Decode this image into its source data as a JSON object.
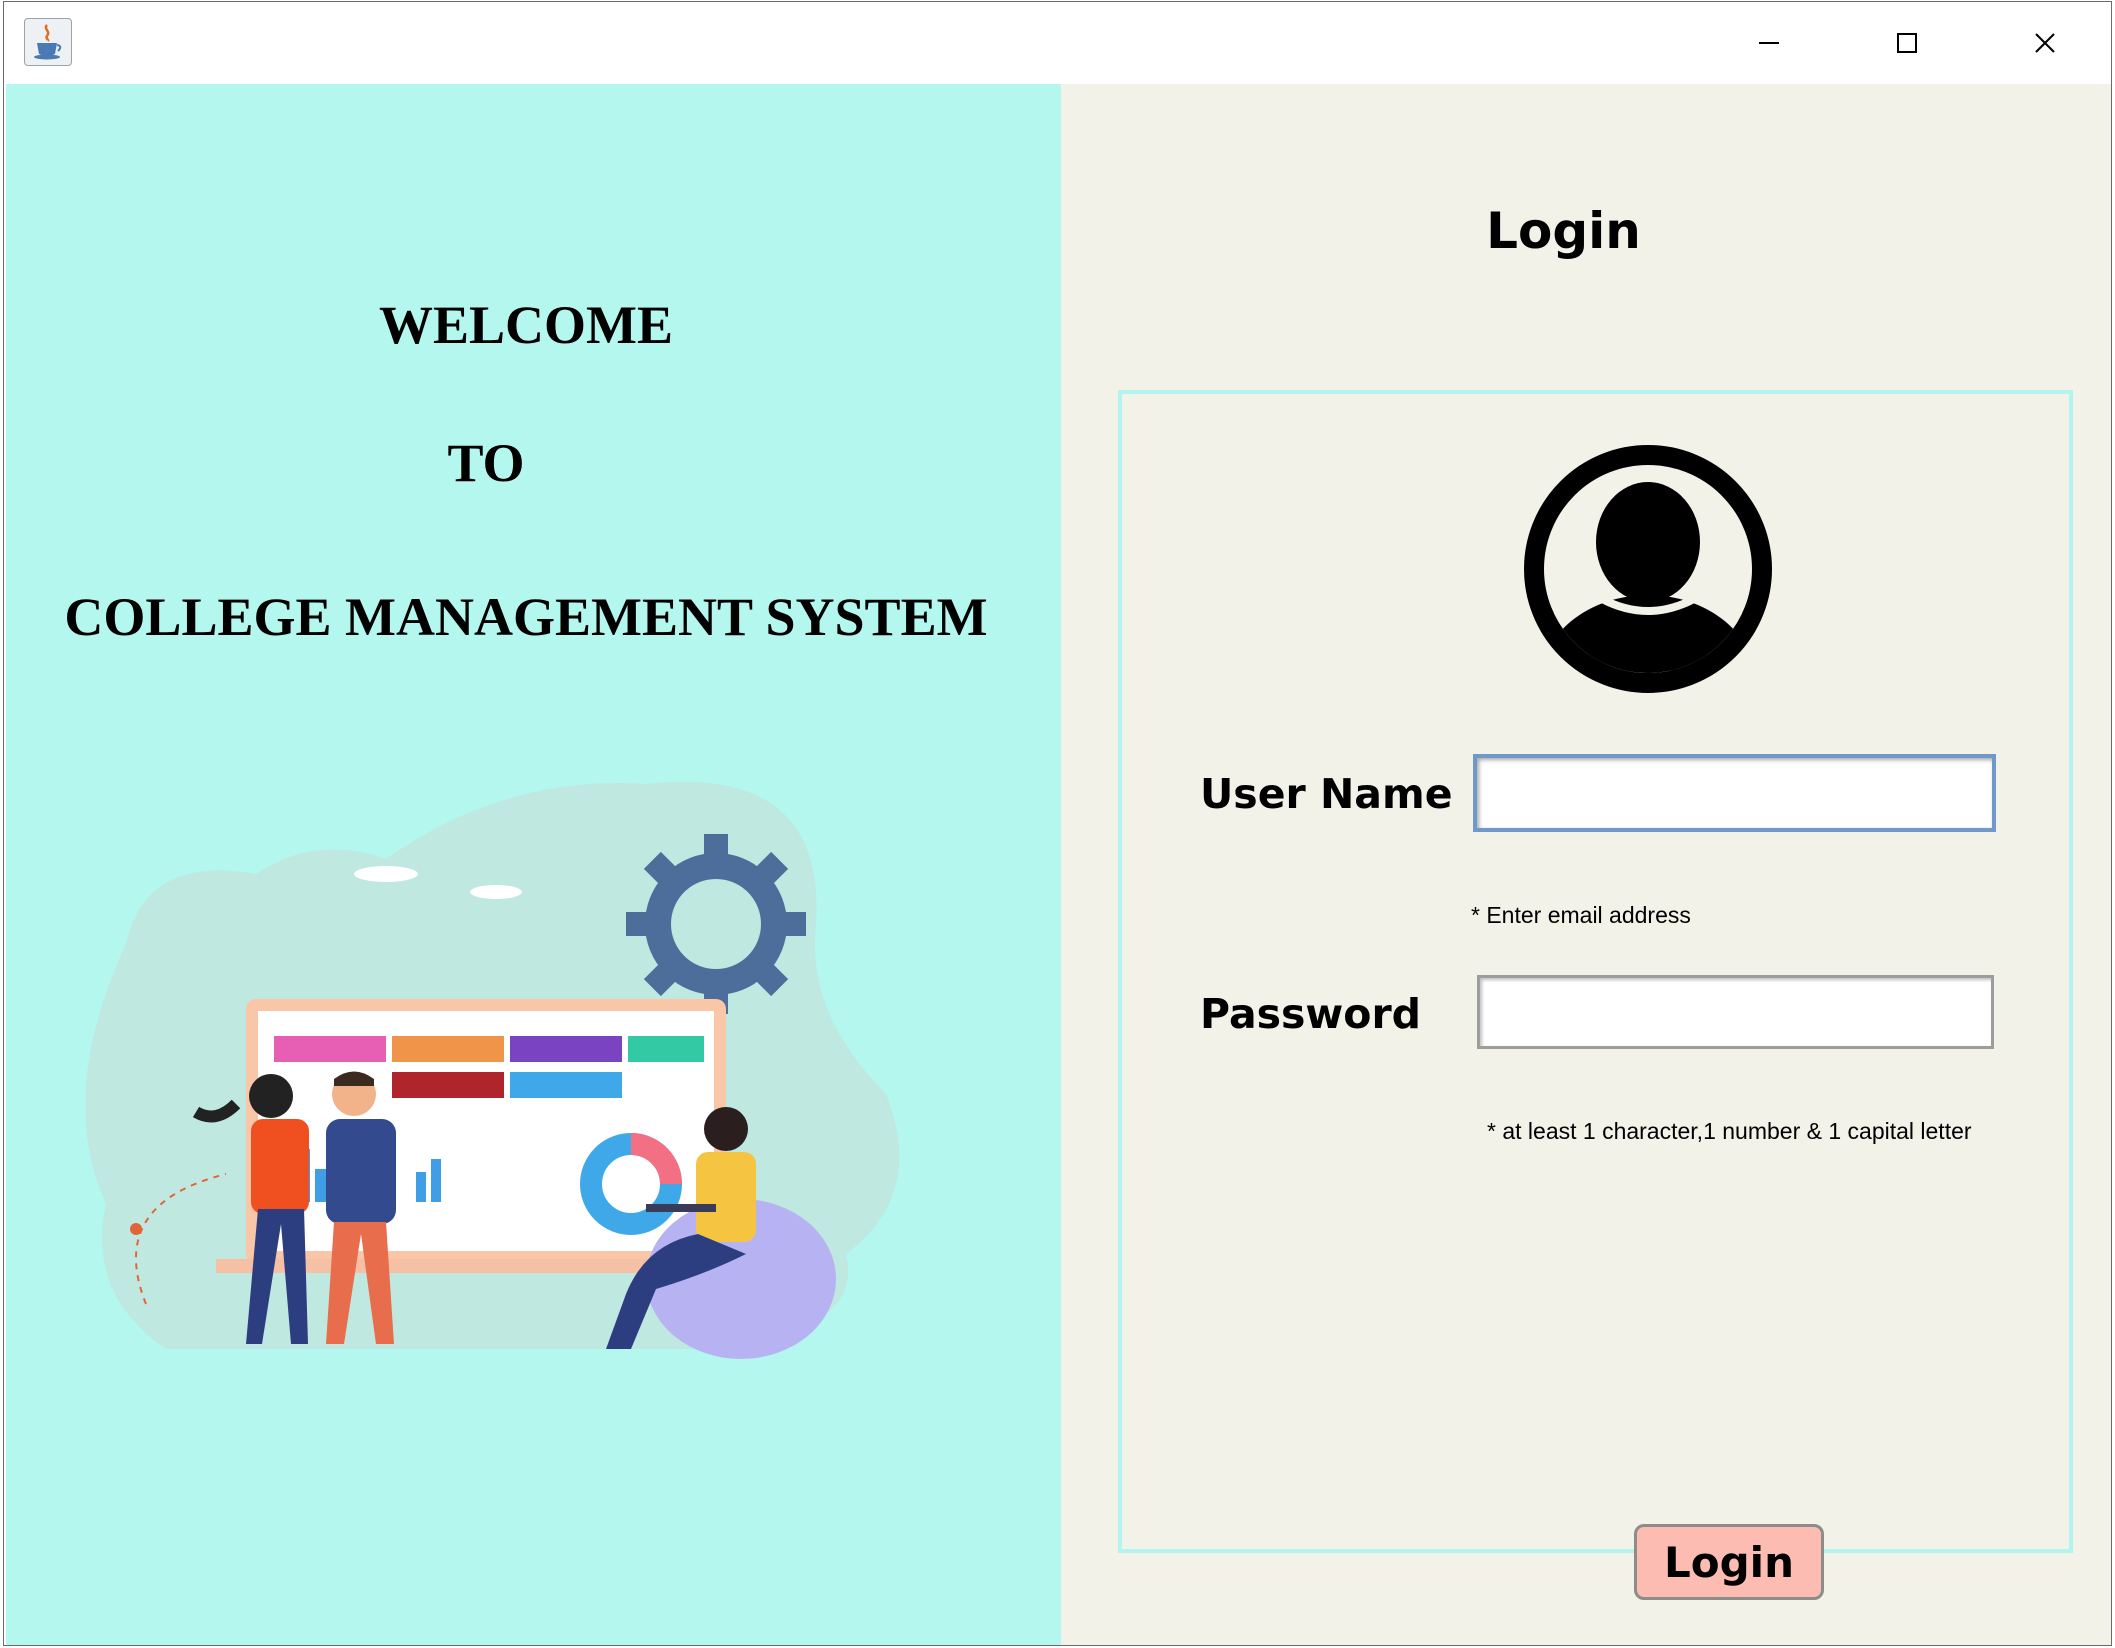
{
  "window": {
    "icon": "java-coffee-cup-icon",
    "controls": [
      "minimize-icon",
      "maximize-icon",
      "close-icon"
    ]
  },
  "welcome": {
    "line1": "WELCOME",
    "line2": "TO",
    "line3": "COLLEGE MANAGEMENT SYSTEM"
  },
  "login": {
    "title": "Login",
    "avatar_icon": "user-avatar-icon",
    "username_label": "User Name",
    "username_value": "",
    "username_hint": "* Enter email address",
    "password_label": "Password",
    "password_value": "",
    "password_hint": "* at least 1 character,1 number & 1 capital letter",
    "button_label": "Login"
  },
  "colors": {
    "left_panel_bg": "#b3f7ee",
    "right_panel_bg": "#f2f2e8",
    "login_button_bg": "#fcbcb1",
    "box_border": "#b4f4ef"
  }
}
